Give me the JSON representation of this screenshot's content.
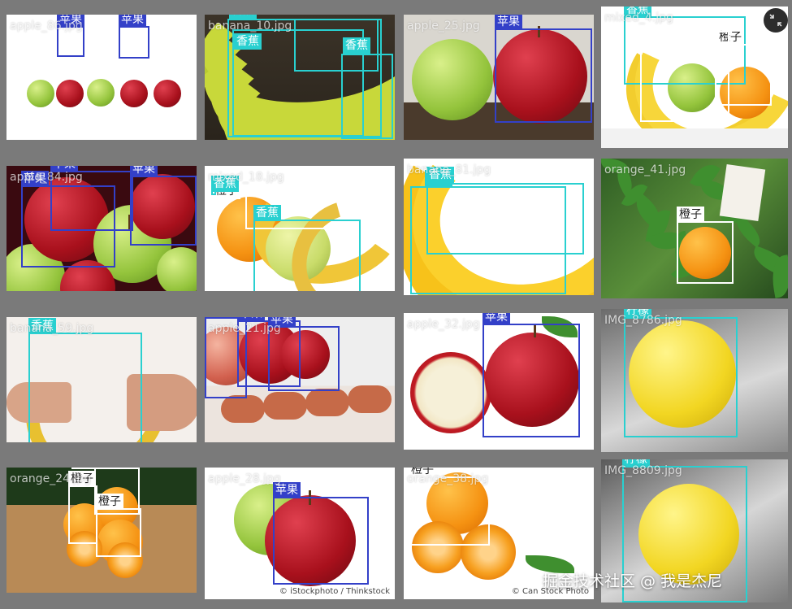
{
  "colors": {
    "apple_box": "#3340c8",
    "fruit_box": "#29d0d0",
    "orange_box": "#ffffff"
  },
  "zoom_icon": "zoom-out-icon",
  "watermark": "掘金技术社区 @ 我是杰尼",
  "tiles": [
    {
      "filename": "apple_86.jpg",
      "credit": "",
      "boxes": [
        {
          "label": "苹果",
          "class": "apple"
        },
        {
          "label": "苹果",
          "class": "apple"
        }
      ]
    },
    {
      "filename": "banana_10.jpg",
      "credit": "",
      "boxes": [
        {
          "label": "香蕉",
          "class": "fruit"
        },
        {
          "label": "香蕉",
          "class": "fruit"
        },
        {
          "label": "香蕉",
          "class": "fruit"
        },
        {
          "label": "",
          "class": "fruit"
        }
      ]
    },
    {
      "filename": "apple_25.jpg",
      "credit": "",
      "boxes": [
        {
          "label": "苹果",
          "class": "apple"
        }
      ]
    },
    {
      "filename": "mixed_4.jpg",
      "credit": "",
      "boxes": [
        {
          "label": "香蕉",
          "class": "fruit"
        },
        {
          "label": "橙子",
          "class": "orange"
        },
        {
          "label": "",
          "class": "orange"
        }
      ]
    },
    {
      "filename": "apple_84.jpg",
      "credit": "",
      "boxes": [
        {
          "label": "苹果",
          "class": "apple"
        },
        {
          "label": "苹果",
          "class": "apple"
        },
        {
          "label": "苹果",
          "class": "apple"
        }
      ]
    },
    {
      "filename": "mixed_18.jpg",
      "credit": "",
      "boxes": [
        {
          "label": "橙子",
          "class": "orange"
        },
        {
          "label": "香蕉",
          "class": "fruit"
        },
        {
          "label": "香蕉",
          "class": "fruit"
        }
      ]
    },
    {
      "filename": "banana_81.jpg",
      "credit": "",
      "boxes": [
        {
          "label": "香蕉",
          "class": "fruit"
        },
        {
          "label": "香蕉",
          "class": "fruit"
        }
      ]
    },
    {
      "filename": "orange_41.jpg",
      "credit": "",
      "boxes": [
        {
          "label": "橙子",
          "class": "orange"
        }
      ]
    },
    {
      "filename": "banana_59.jpg",
      "credit": "",
      "boxes": [
        {
          "label": "香蕉",
          "class": "fruit"
        }
      ]
    },
    {
      "filename": "apple_21.jpg",
      "credit": "",
      "boxes": [
        {
          "label": "苹果",
          "class": "apple"
        },
        {
          "label": "苹果",
          "class": "apple"
        },
        {
          "label": "苹果",
          "class": "apple"
        }
      ]
    },
    {
      "filename": "apple_32.jpg",
      "credit": "",
      "boxes": [
        {
          "label": "苹果",
          "class": "apple"
        }
      ]
    },
    {
      "filename": "IMG_8786.jpg",
      "credit": "",
      "boxes": [
        {
          "label": "柠檬",
          "class": "fruit"
        }
      ]
    },
    {
      "filename": "orange_24.jpg",
      "credit": "",
      "boxes": [
        {
          "label": "橙子",
          "class": "orange"
        },
        {
          "label": "橙子",
          "class": "orange"
        },
        {
          "label": "橙子",
          "class": "orange"
        }
      ]
    },
    {
      "filename": "apple_28.jpg",
      "credit": "© iStockphoto / Thinkstock",
      "boxes": [
        {
          "label": "苹果",
          "class": "apple"
        }
      ]
    },
    {
      "filename": "orange_38.jpg",
      "credit": "© Can Stock Photo",
      "boxes": [
        {
          "label": "橙子",
          "class": "orange"
        }
      ]
    },
    {
      "filename": "IMG_8809.jpg",
      "credit": "",
      "boxes": [
        {
          "label": "柠檬",
          "class": "fruit"
        }
      ]
    }
  ]
}
